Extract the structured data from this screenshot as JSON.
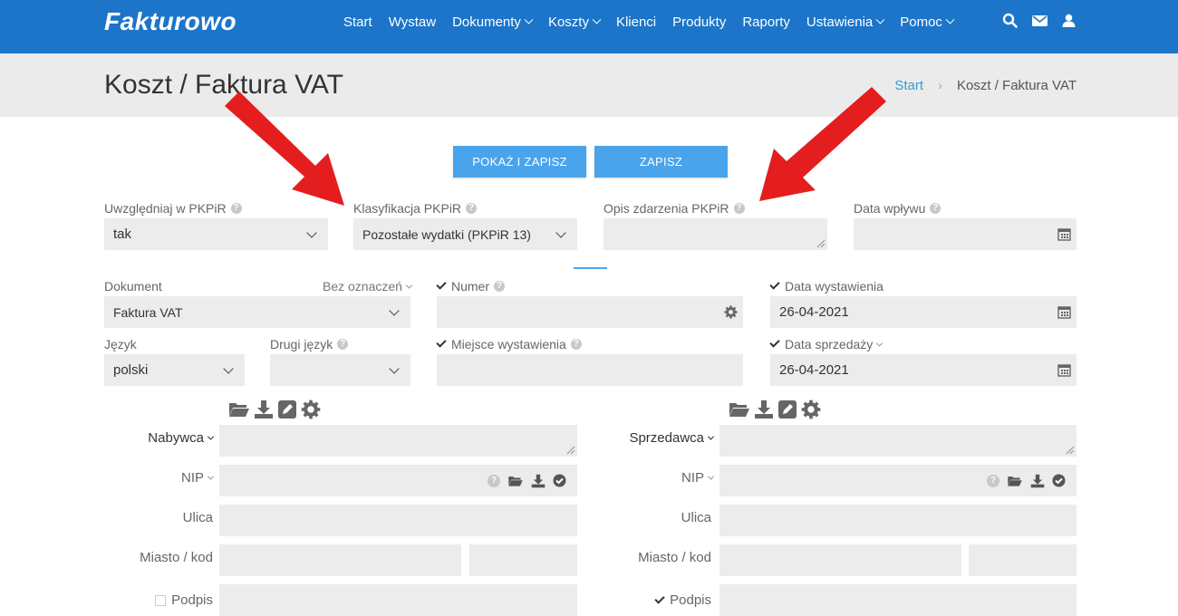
{
  "app": {
    "logo": "Fakturowo"
  },
  "nav": {
    "items": [
      {
        "label": "Start",
        "dropdown": false
      },
      {
        "label": "Wystaw",
        "dropdown": false
      },
      {
        "label": "Dokumenty",
        "dropdown": true
      },
      {
        "label": "Koszty",
        "dropdown": true
      },
      {
        "label": "Klienci",
        "dropdown": false
      },
      {
        "label": "Produkty",
        "dropdown": false
      },
      {
        "label": "Raporty",
        "dropdown": false
      },
      {
        "label": "Ustawienia",
        "dropdown": true
      },
      {
        "label": "Pomoc",
        "dropdown": true
      }
    ],
    "icons": [
      "search-icon",
      "envelope-icon",
      "user-icon"
    ]
  },
  "header": {
    "title": "Koszt / Faktura VAT",
    "breadcrumb": {
      "home": "Start",
      "separator": "›",
      "current": "Koszt / Faktura VAT"
    }
  },
  "actions": {
    "show_save": "POKAŻ I ZAPISZ",
    "save": "ZAPISZ"
  },
  "pkpir": {
    "include_label": "Uwzględniaj w PKPiR",
    "include_value": "tak",
    "class_label": "Klasyfikacja PKPiR",
    "class_value": "Pozostałe wydatki (PKPiR 13)",
    "desc_label": "Opis zdarzenia PKPiR",
    "desc_value": "",
    "receipt_label": "Data wpływu",
    "receipt_value": ""
  },
  "document": {
    "doc_label": "Dokument",
    "doc_marking": "Bez oznaczeń",
    "doc_value": "Faktura VAT",
    "number_label": "Numer",
    "number_value": "",
    "issue_date_label": "Data wystawienia",
    "issue_date_value": "26-04-2021",
    "lang_label": "Język",
    "lang_value": "polski",
    "lang2_label": "Drugi język",
    "lang2_value": "",
    "place_label": "Miejsce wystawienia",
    "place_value": "",
    "sale_date_label": "Data sprzedaży",
    "sale_date_value": "26-04-2021"
  },
  "buyer": {
    "title": "Nabywca",
    "nip": "NIP",
    "street": "Ulica",
    "city": "Miasto / kod",
    "signature": "Podpis",
    "signature_checked": false
  },
  "seller": {
    "title": "Sprzedawca",
    "nip": "NIP",
    "street": "Ulica",
    "city": "Miasto / kod",
    "signature": "Podpis",
    "signature_checked": true
  },
  "colors": {
    "nav_bg": "#1c75c8",
    "accent": "#4aa4ec",
    "field_bg": "#ececec",
    "arrow": "#e41e1e"
  }
}
